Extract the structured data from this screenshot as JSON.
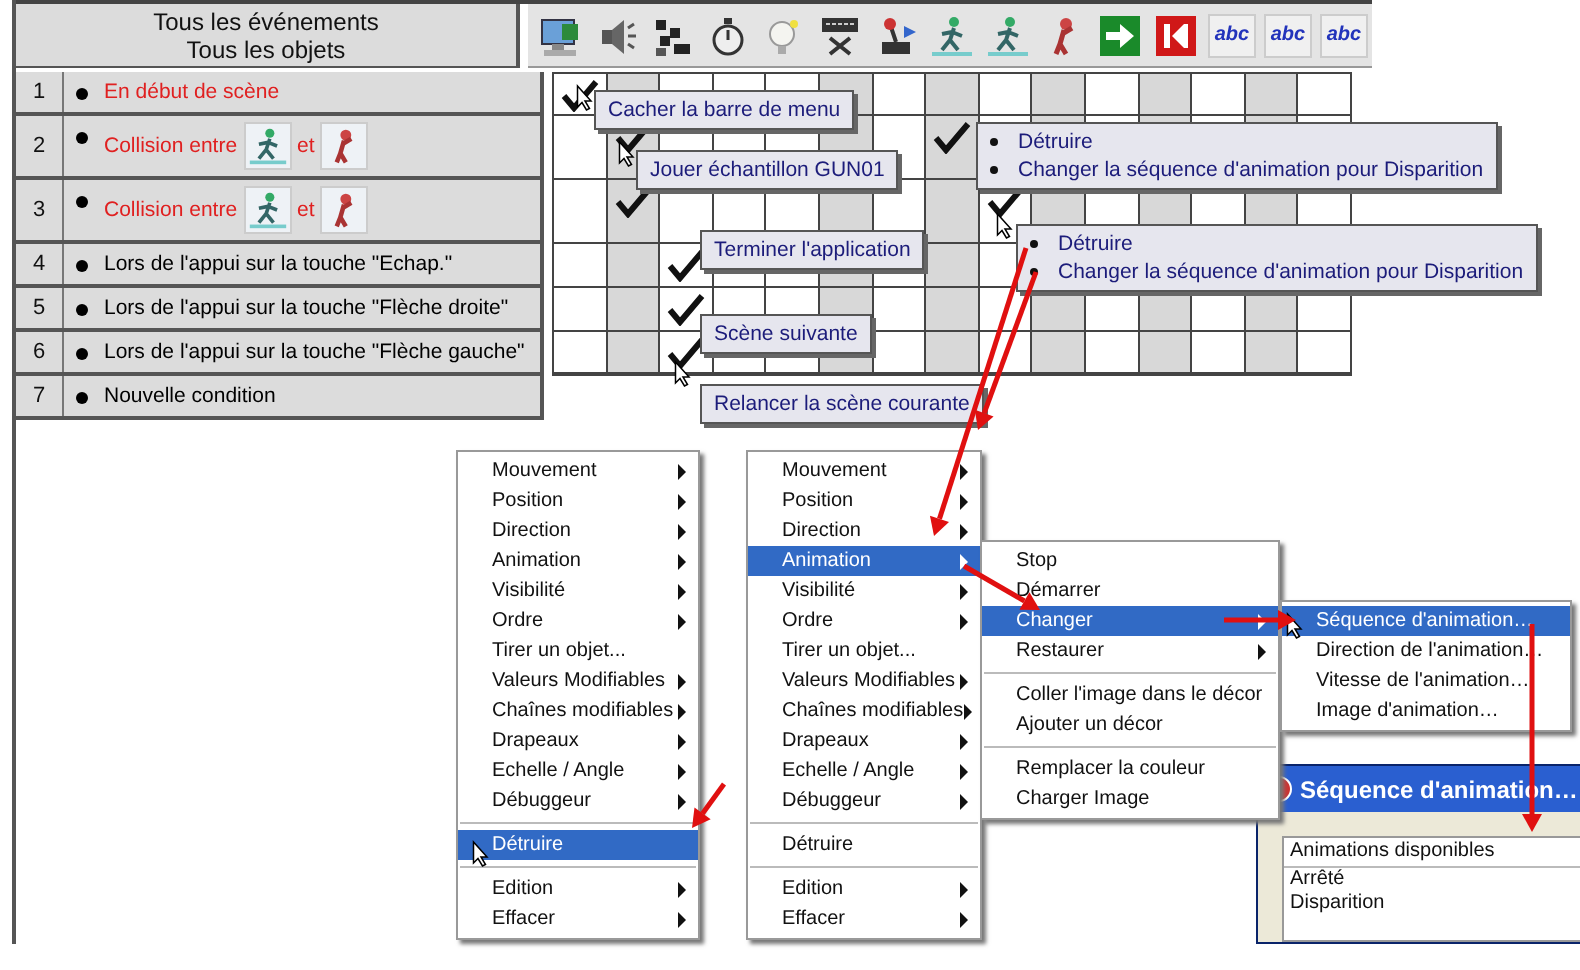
{
  "header": {
    "line_1": "Tous les événements",
    "line_2": "Tous les objets"
  },
  "object_icons": [
    {
      "kind": "computer"
    },
    {
      "kind": "speaker"
    },
    {
      "kind": "pattern"
    },
    {
      "kind": "stopwatch"
    },
    {
      "kind": "bulb"
    },
    {
      "kind": "keyboard"
    },
    {
      "kind": "joystick"
    },
    {
      "kind": "runner"
    },
    {
      "kind": "runner"
    },
    {
      "kind": "figure"
    },
    {
      "kind": "arrow"
    },
    {
      "kind": "k"
    },
    {
      "kind": "text",
      "label": "abc"
    },
    {
      "kind": "text",
      "label": "abc"
    },
    {
      "kind": "text",
      "label": "abc"
    }
  ],
  "events": [
    {
      "number": "1",
      "color": "#e02020",
      "parts": [
        {
          "kind": "text",
          "text": "En début de scène"
        }
      ],
      "checks": [
        true,
        false,
        false,
        false,
        false,
        false,
        false,
        false,
        false,
        false,
        false,
        false,
        false,
        false,
        false
      ]
    },
    {
      "number": "2",
      "color": "#e02020",
      "parts": [
        {
          "kind": "text",
          "text": "Collision entre"
        },
        {
          "kind": "runner"
        },
        {
          "kind": "text",
          "text": "et"
        },
        {
          "kind": "figure"
        }
      ],
      "checks": [
        false,
        true,
        false,
        false,
        false,
        false,
        false,
        true,
        false,
        false,
        false,
        false,
        false,
        false,
        false
      ]
    },
    {
      "number": "3",
      "color": "#e02020",
      "parts": [
        {
          "kind": "text",
          "text": "Collision entre"
        },
        {
          "kind": "runner"
        },
        {
          "kind": "text",
          "text": "et"
        },
        {
          "kind": "figure"
        }
      ],
      "checks": [
        false,
        true,
        false,
        false,
        false,
        false,
        false,
        false,
        true,
        false,
        false,
        false,
        false,
        false,
        false
      ]
    },
    {
      "number": "4",
      "color": "#000000",
      "parts": [
        {
          "kind": "text",
          "text": "Lors de l'appui sur la touche \"Echap.\""
        }
      ],
      "checks": [
        false,
        false,
        true,
        false,
        false,
        false,
        false,
        false,
        false,
        false,
        false,
        false,
        false,
        false,
        false
      ]
    },
    {
      "number": "5",
      "color": "#000000",
      "parts": [
        {
          "kind": "text",
          "text": "Lors de l'appui sur la touche \"Flèche droite\""
        }
      ],
      "checks": [
        false,
        false,
        true,
        false,
        false,
        false,
        false,
        false,
        false,
        false,
        false,
        false,
        false,
        false,
        false
      ]
    },
    {
      "number": "6",
      "color": "#000000",
      "parts": [
        {
          "kind": "text",
          "text": "Lors de l'appui sur la touche \"Flèche gauche\""
        }
      ],
      "checks": [
        false,
        false,
        true,
        false,
        false,
        false,
        false,
        false,
        false,
        false,
        false,
        false,
        false,
        false,
        false
      ]
    },
    {
      "number": "7",
      "color": "#000000",
      "parts": [
        {
          "kind": "text",
          "text": "Nouvelle condition"
        }
      ]
    }
  ],
  "action_popups": [
    {
      "lines": [
        "Cacher la barre de menu"
      ],
      "bulleted": false
    },
    {
      "lines": [
        "Jouer échantillon GUN01"
      ],
      "bulleted": false
    },
    {
      "lines": [
        "Détruire",
        "Changer la séquence d'animation pour Disparition"
      ],
      "bulleted": true
    },
    {
      "lines": [
        "Terminer l'application"
      ],
      "bulleted": false
    },
    {
      "lines": [
        "Détruire",
        "Changer la séquence d'animation pour Disparition"
      ],
      "bulleted": true
    },
    {
      "lines": [
        "Scène suivante"
      ],
      "bulleted": false
    },
    {
      "lines": [
        "Relancer la scène courante"
      ],
      "bulleted": false
    }
  ],
  "menus": [
    {
      "items": [
        {
          "label": "Mouvement",
          "submenu": true,
          "selected": false
        },
        {
          "label": "Position",
          "submenu": true,
          "selected": false
        },
        {
          "label": "Direction",
          "submenu": true,
          "selected": false
        },
        {
          "label": "Animation",
          "submenu": true,
          "selected": false
        },
        {
          "label": "Visibilité",
          "submenu": true,
          "selected": false
        },
        {
          "label": "Ordre",
          "submenu": true,
          "selected": false
        },
        {
          "label": "Tirer un objet...",
          "submenu": false,
          "selected": false
        },
        {
          "label": "Valeurs Modifiables",
          "submenu": true,
          "selected": false
        },
        {
          "label": "Chaînes modifiables",
          "submenu": true,
          "selected": false
        },
        {
          "label": "Drapeaux",
          "submenu": true,
          "selected": false
        },
        {
          "label": "Echelle / Angle",
          "submenu": true,
          "selected": false
        },
        {
          "label": "Débuggeur",
          "submenu": true,
          "selected": false
        },
        {
          "kind": "separator"
        },
        {
          "label": "Détruire",
          "submenu": false,
          "selected": true
        },
        {
          "kind": "separator"
        },
        {
          "label": "Edition",
          "submenu": true,
          "selected": false
        },
        {
          "label": "Effacer",
          "submenu": true,
          "selected": false
        }
      ]
    },
    {
      "items": [
        {
          "label": "Mouvement",
          "submenu": true,
          "selected": false
        },
        {
          "label": "Position",
          "submenu": true,
          "selected": false
        },
        {
          "label": "Direction",
          "submenu": true,
          "selected": false
        },
        {
          "label": "Animation",
          "submenu": true,
          "selected": true
        },
        {
          "label": "Visibilité",
          "submenu": true,
          "selected": false
        },
        {
          "label": "Ordre",
          "submenu": true,
          "selected": false
        },
        {
          "label": "Tirer un objet...",
          "submenu": false,
          "selected": false
        },
        {
          "label": "Valeurs Modifiables",
          "submenu": true,
          "selected": false
        },
        {
          "label": "Chaînes modifiables",
          "submenu": true,
          "selected": false
        },
        {
          "label": "Drapeaux",
          "submenu": true,
          "selected": false
        },
        {
          "label": "Echelle / Angle",
          "submenu": true,
          "selected": false
        },
        {
          "label": "Débuggeur",
          "submenu": true,
          "selected": false
        },
        {
          "kind": "separator"
        },
        {
          "label": "Détruire",
          "submenu": false,
          "selected": false
        },
        {
          "kind": "separator"
        },
        {
          "label": "Edition",
          "submenu": true,
          "selected": false
        },
        {
          "label": "Effacer",
          "submenu": true,
          "selected": false
        }
      ]
    },
    {
      "items": [
        {
          "label": "Stop",
          "submenu": false,
          "selected": false
        },
        {
          "label": "Démarrer",
          "submenu": false,
          "selected": false
        },
        {
          "label": "Changer",
          "submenu": true,
          "selected": true
        },
        {
          "label": "Restaurer",
          "submenu": true,
          "selected": false
        },
        {
          "kind": "separator"
        },
        {
          "label": "Coller l'image dans le décor",
          "submenu": false,
          "selected": false
        },
        {
          "label": "Ajouter un décor",
          "submenu": false,
          "selected": false
        },
        {
          "kind": "separator"
        },
        {
          "label": "Remplacer la couleur",
          "submenu": false,
          "selected": false
        },
        {
          "label": "Charger Image",
          "submenu": false,
          "selected": false
        }
      ]
    },
    {
      "items": [
        {
          "label": "Séquence d'animation…",
          "submenu": false,
          "selected": true
        },
        {
          "label": "Direction de l'animation…",
          "submenu": false,
          "selected": false
        },
        {
          "label": "Vitesse de l'animation…",
          "submenu": false,
          "selected": false
        },
        {
          "label": "Image d'animation…",
          "submenu": false,
          "selected": false
        }
      ]
    }
  ],
  "dialog": {
    "title": "Séquence d'animation…",
    "list_header": "Animations disponibles",
    "items": [
      "Arrêté",
      "Disparition"
    ]
  }
}
